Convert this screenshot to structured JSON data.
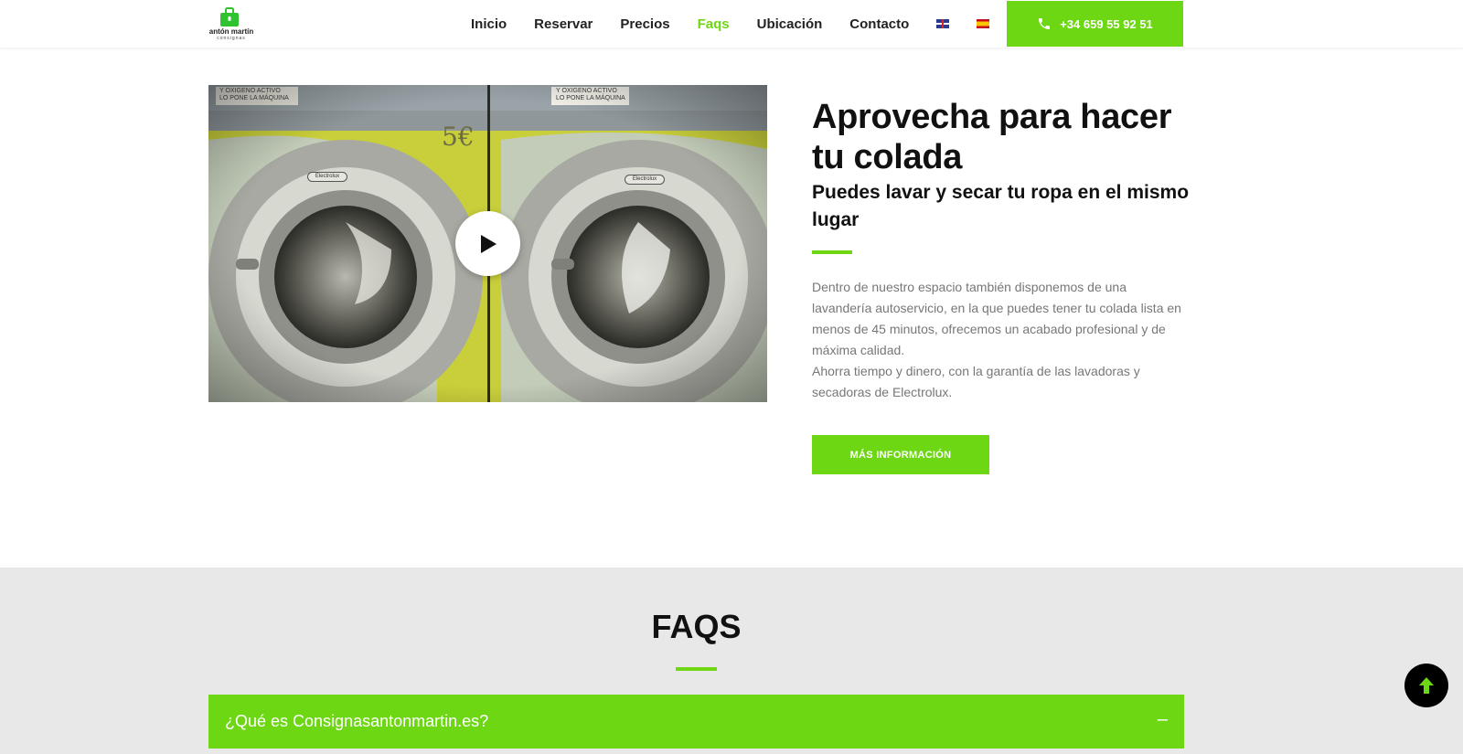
{
  "brand": {
    "name": "antón martín",
    "sub": "consignas",
    "color": "#6dd714"
  },
  "nav": {
    "items": [
      {
        "label": "Inicio",
        "active": false
      },
      {
        "label": "Reservar",
        "active": false
      },
      {
        "label": "Precios",
        "active": false
      },
      {
        "label": "Faqs",
        "active": true
      },
      {
        "label": "Ubicación",
        "active": false
      },
      {
        "label": "Contacto",
        "active": false
      }
    ],
    "flags": [
      "uk-flag-icon",
      "spain-flag-icon"
    ],
    "phone_label": "+34 659 55 92 51",
    "phone_icon": "phone-icon"
  },
  "video": {
    "price_label": "5€",
    "play_icon": "play-icon",
    "panel_left_line1": "Y OXIGENO ACTIVO",
    "panel_left_line2": "LO PONE LA MÁQUINA",
    "panel_right_line1": "Y OXIGENO ACTIVO",
    "panel_right_line2": "LO PONE LA MÁQUINA",
    "badge": "Electrolux"
  },
  "promo": {
    "title": "Aprovecha para hacer tu colada",
    "subtitle": "Puedes lavar y secar tu ropa en el mismo lugar",
    "paragraph1": "Dentro de nuestro espacio también disponemos de una lavandería autoservicio, en la que puedes tener tu colada lista en menos de 45 minutos, ofrecemos un acabado profesional y de máxima calidad.",
    "paragraph2": "Ahorra tiempo y dinero, con la garantía de las lavadoras y secadoras de Electrolux.",
    "button_label": "MÁS INFORMACIÓN"
  },
  "faqs": {
    "title": "FAQS",
    "items": [
      {
        "question": "¿Qué es Consignasantonmartin.es?",
        "toggle": "–"
      }
    ]
  },
  "scroll_top_icon": "arrow-up-icon"
}
